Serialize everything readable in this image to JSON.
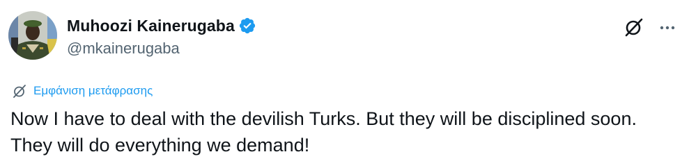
{
  "author": {
    "display_name": "Muhoozi Kainerugaba",
    "handle": "@mkainerugaba",
    "verified": true
  },
  "icons": {
    "avatar": "profile-photo",
    "verified": "verified-badge-icon",
    "grok": "grok-icon",
    "more": "more-dots-icon",
    "translate": "translate-icon"
  },
  "translate": {
    "label": "Εμφάνιση μετάφρασης"
  },
  "tweet": {
    "text": "Now I have to deal with the devilish Turks. But they will be disciplined soon. They will do everything we demand!"
  },
  "colors": {
    "accent": "#1d9bf0",
    "text": "#0f1419",
    "secondary": "#536471"
  }
}
